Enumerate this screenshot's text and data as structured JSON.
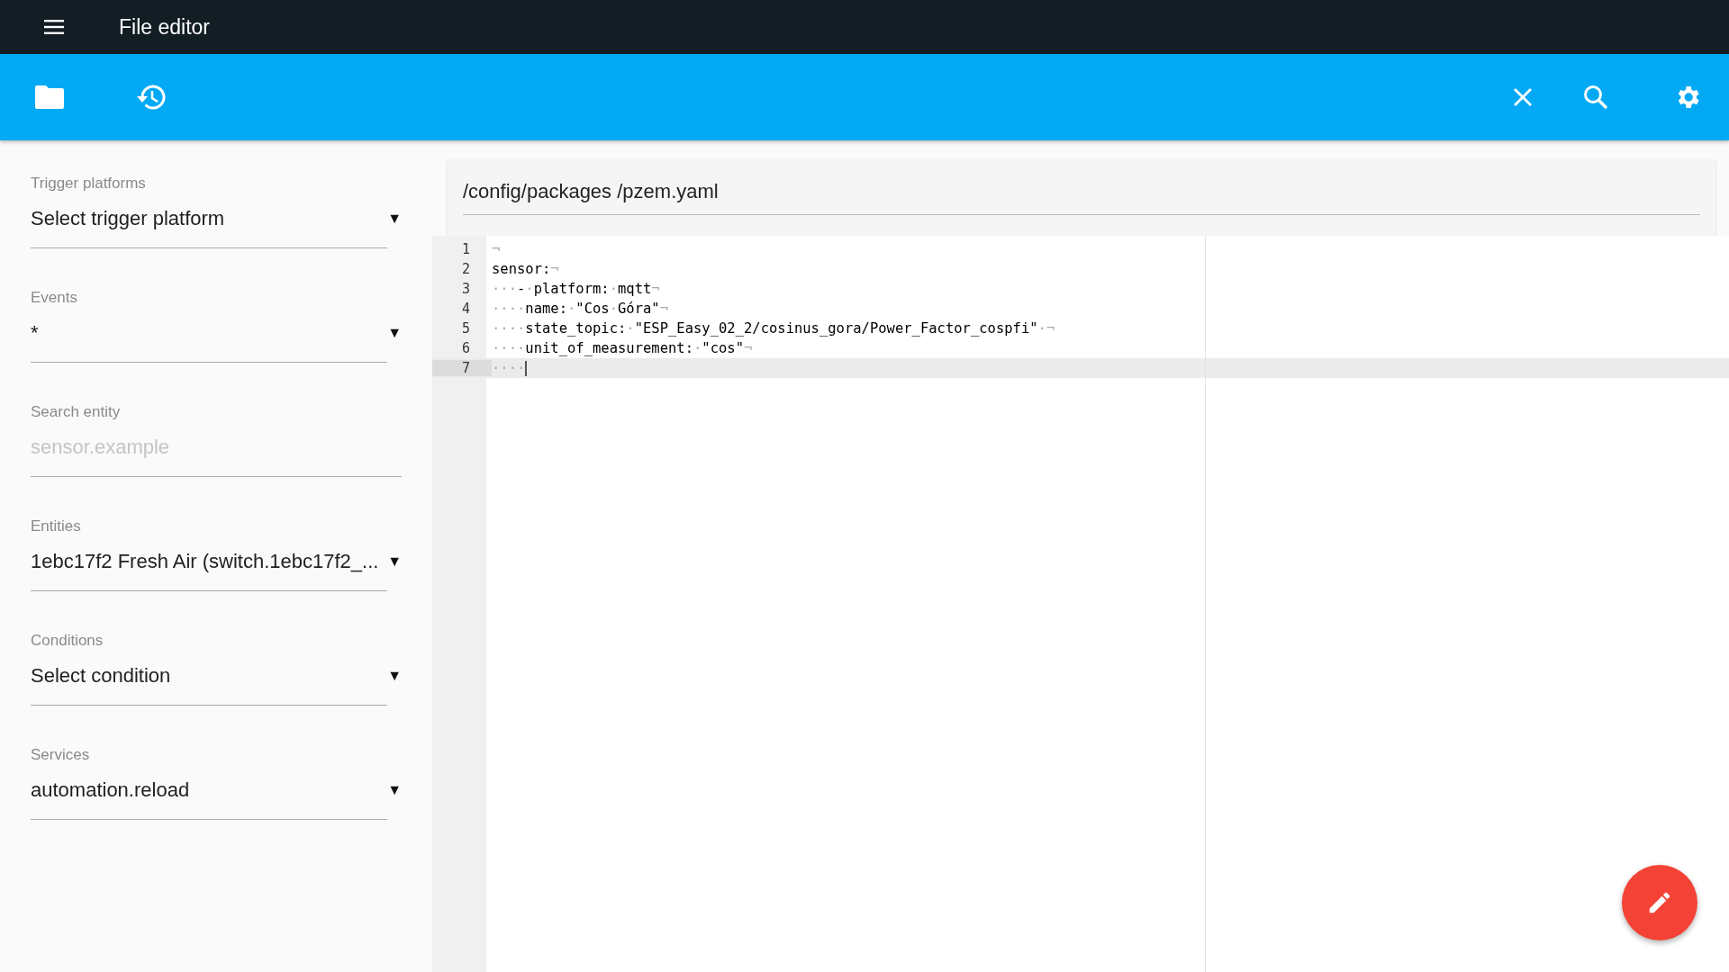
{
  "app_bar": {
    "title": "File editor"
  },
  "sidebar": {
    "fields": [
      {
        "kind": "select",
        "label": "Trigger platforms",
        "value": "Select trigger platform",
        "arrow": "▼"
      },
      {
        "kind": "select",
        "label": "Events",
        "value": "*",
        "arrow": "▼"
      },
      {
        "kind": "input",
        "label": "Search entity",
        "placeholder": "sensor.example"
      },
      {
        "kind": "select",
        "label": "Entities",
        "value": "1ebc17f2 Fresh Air (switch.1ebc17f2_...",
        "arrow": "▼"
      },
      {
        "kind": "select",
        "label": "Conditions",
        "value": "Select condition",
        "arrow": "▼"
      },
      {
        "kind": "select",
        "label": "Services",
        "value": "automation.reload",
        "arrow": "▼"
      }
    ]
  },
  "editor": {
    "file_path": "/config/packages /pzem.yaml",
    "lines": [
      {
        "number": "1",
        "active": false,
        "segments": [
          {
            "kind": "ws",
            "text": "¬"
          }
        ]
      },
      {
        "number": "2",
        "active": false,
        "segments": [
          {
            "kind": "code",
            "text": "sensor:"
          },
          {
            "kind": "ws",
            "text": "¬"
          }
        ]
      },
      {
        "number": "3",
        "active": false,
        "segments": [
          {
            "kind": "ws",
            "text": "···"
          },
          {
            "kind": "code",
            "text": "-"
          },
          {
            "kind": "ws",
            "text": "·"
          },
          {
            "kind": "code",
            "text": "platform:"
          },
          {
            "kind": "ws",
            "text": "·"
          },
          {
            "kind": "code",
            "text": "mqtt"
          },
          {
            "kind": "ws",
            "text": "¬"
          }
        ]
      },
      {
        "number": "4",
        "active": false,
        "segments": [
          {
            "kind": "ws",
            "text": "····"
          },
          {
            "kind": "code",
            "text": "name:"
          },
          {
            "kind": "ws",
            "text": "·"
          },
          {
            "kind": "code",
            "text": "\"Cos"
          },
          {
            "kind": "ws",
            "text": "·"
          },
          {
            "kind": "code",
            "text": "Góra\""
          },
          {
            "kind": "ws",
            "text": "¬"
          }
        ]
      },
      {
        "number": "5",
        "active": false,
        "segments": [
          {
            "kind": "ws",
            "text": "····"
          },
          {
            "kind": "code",
            "text": "state_topic:"
          },
          {
            "kind": "ws",
            "text": "·"
          },
          {
            "kind": "code",
            "text": "\"ESP_Easy_02_2/cosinus_gora/Power_Factor_cospfi\""
          },
          {
            "kind": "ws",
            "text": "·¬"
          }
        ]
      },
      {
        "number": "6",
        "active": false,
        "segments": [
          {
            "kind": "ws",
            "text": "····"
          },
          {
            "kind": "code",
            "text": "unit_of_measurement:"
          },
          {
            "kind": "ws",
            "text": "·"
          },
          {
            "kind": "code",
            "text": "\"cos\""
          },
          {
            "kind": "ws",
            "text": "¬"
          }
        ]
      },
      {
        "number": "7",
        "active": true,
        "segments": [
          {
            "kind": "ws",
            "text": "····"
          }
        ]
      }
    ]
  }
}
